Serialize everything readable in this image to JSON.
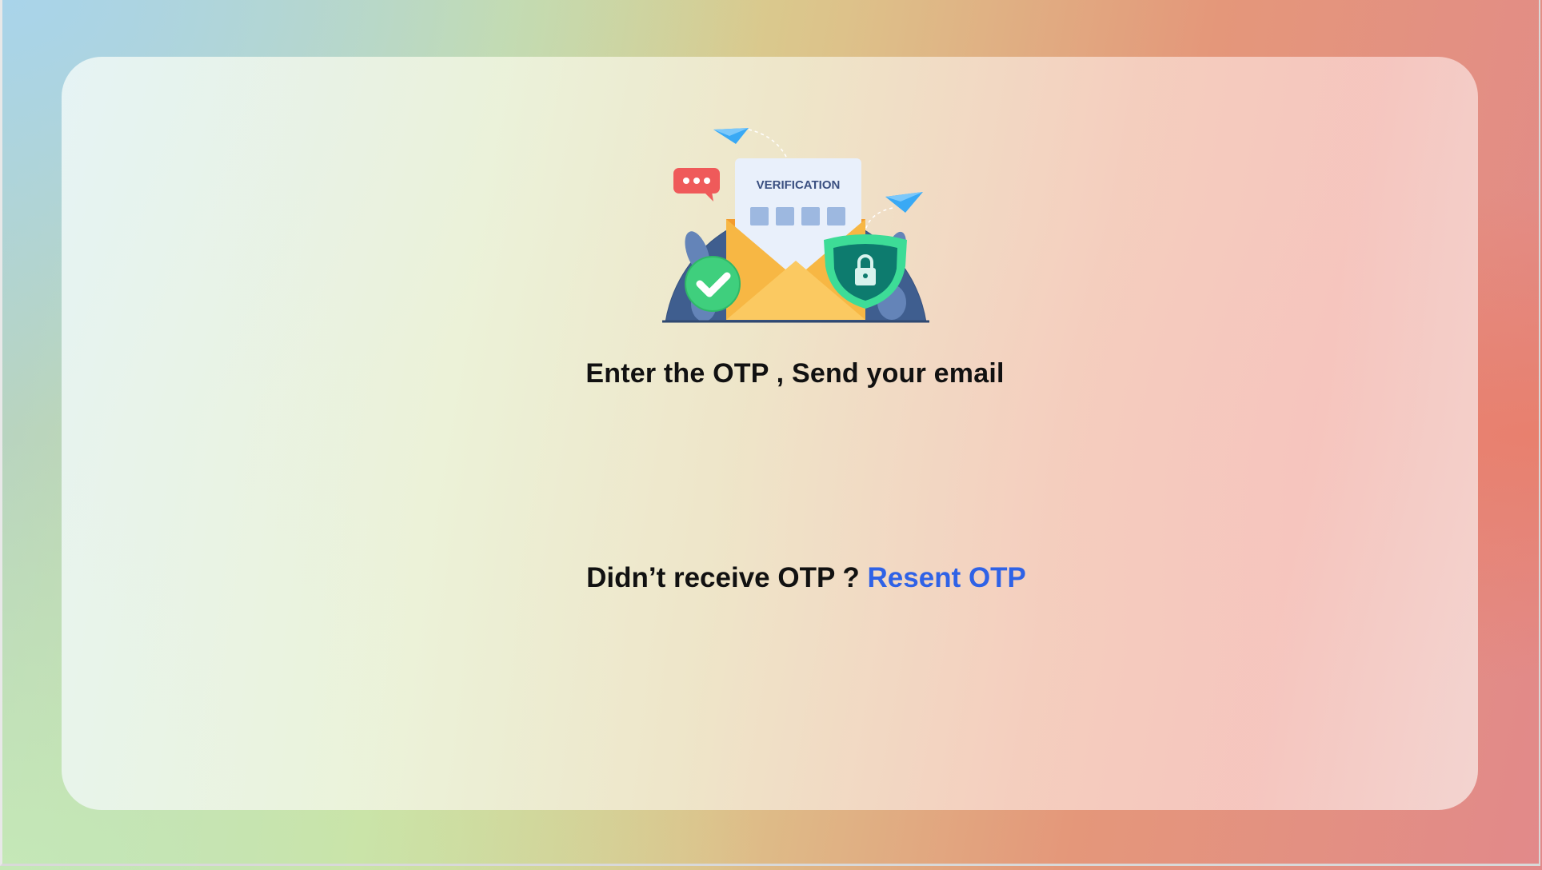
{
  "verification": {
    "illustration": {
      "icon": "email-verification-illustration",
      "card_label": "VERIFICATION"
    },
    "heading": "Enter the OTP , Send your email",
    "resend_prompt": "Didn’t receive OTP ?",
    "resend_link": "Resent OTP"
  },
  "colors": {
    "link": "#2f62e6",
    "text": "#111111",
    "illustration_backdrop": "#3f5e8f",
    "envelope": "#f7b744",
    "shield": "#3ddc97",
    "check_badge": "#3fcf7d",
    "chat_bubble": "#ef5a5a",
    "paper_plane": "#39a9f5"
  }
}
